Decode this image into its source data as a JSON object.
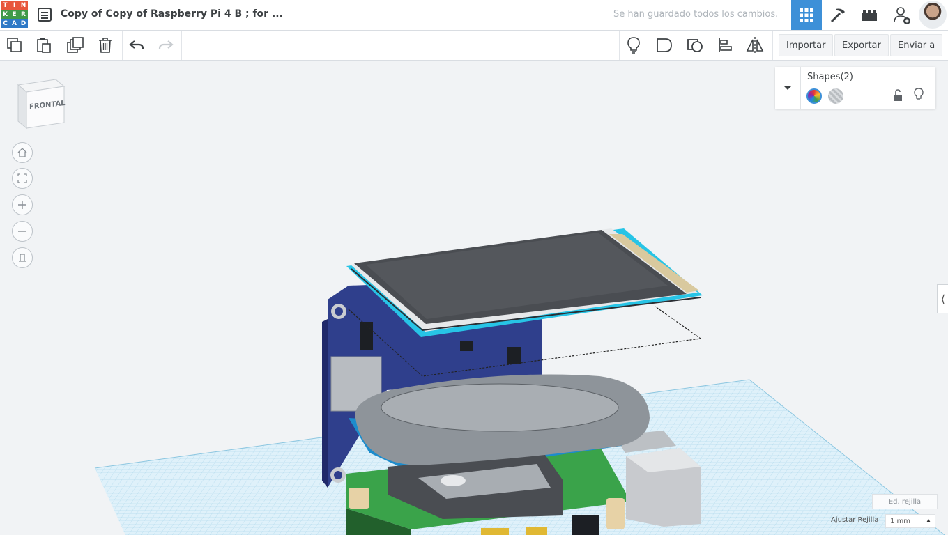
{
  "app": {
    "logo_letters": [
      "T",
      "I",
      "N",
      "K",
      "E",
      "R",
      "C",
      "A",
      "D"
    ],
    "logo_colors": [
      "#e8563c",
      "#e8563c",
      "#e8563c",
      "#3f9a49",
      "#3f9a49",
      "#3f9a49",
      "#2e79c6",
      "#2e79c6",
      "#2e79c6"
    ],
    "title": "Copy of Copy of Raspberry Pi 4 B ; for ...",
    "saved_status": "Se han guardado todos los cambios."
  },
  "header": {
    "modes": [
      {
        "icon": "grid-3d-icon",
        "active": true
      },
      {
        "icon": "pickaxe-icon",
        "active": false
      },
      {
        "icon": "bricks-icon",
        "active": false
      },
      {
        "icon": "add-user-icon",
        "active": false
      }
    ]
  },
  "toolbar": {
    "left_icons": [
      "copy-icon",
      "paste-icon",
      "duplicate-icon",
      "delete-icon",
      "undo-icon",
      "redo-icon"
    ],
    "right_icons": [
      "light-bulb-icon",
      "group-icon",
      "ungroup-icon",
      "align-icon",
      "mirror-icon"
    ],
    "import_label": "Importar",
    "export_label": "Exportar",
    "send_label": "Enviar a"
  },
  "viewcube": {
    "face_label": "FRONTAL"
  },
  "nav_controls": [
    "home-icon",
    "fit-icon",
    "zoom-in-icon",
    "zoom-out-icon",
    "perspective-icon"
  ],
  "shapes_panel": {
    "title": "Shapes(2)",
    "solid_label": "solid-color",
    "hole_label": "hole"
  },
  "grid": {
    "edit_grid_label": "Ed. rejilla",
    "snap_label": "Ajustar Rejilla",
    "snap_value": "1 mm"
  },
  "colors": {
    "accent": "#3d90d8",
    "grid": "#c7e6f5",
    "board_blue": "#2f3f8c",
    "board_green": "#3aa34a",
    "selection": "#27c4e6"
  }
}
